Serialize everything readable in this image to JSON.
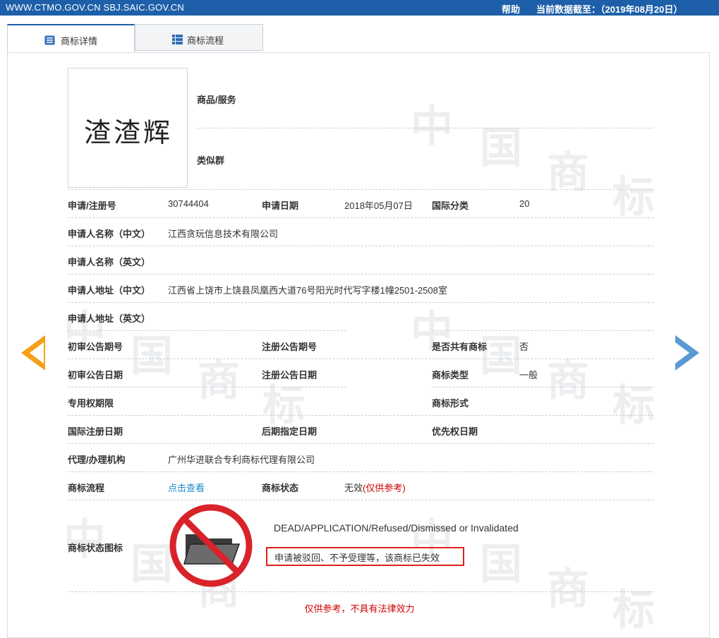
{
  "topbar": {
    "sites": "WWW.CTMO.GOV.CN SBJ.SAIC.GOV.CN",
    "help": "帮助",
    "data_date": "当前数据截至：（2019年08月20日）"
  },
  "tabs": [
    {
      "label": "商标详情",
      "icon": "list-doc-icon",
      "active": true
    },
    {
      "label": "商标流程",
      "icon": "list-grid-icon",
      "active": false
    }
  ],
  "trademark": {
    "image_text": "渣渣辉"
  },
  "goods": {
    "goods_label": "商品/服务",
    "similar_label": "类似群"
  },
  "fields": {
    "reg_no_label": "申请/注册号",
    "reg_no": "30744404",
    "app_date_label": "申请日期",
    "app_date": "2018年05月07日",
    "intl_class_label": "国际分类",
    "intl_class": "20",
    "applicant_cn_label": "申请人名称（中文）",
    "applicant_cn": "江西贪玩信息技术有限公司",
    "applicant_en_label": "申请人名称（英文）",
    "address_cn_label": "申请人地址（中文）",
    "address_cn": "江西省上饶市上饶县凤凰西大道76号阳光时代写字楼1幢2501-2508室",
    "address_en_label": "申请人地址（英文）",
    "prelim_issue_label": "初审公告期号",
    "reg_issue_label": "注册公告期号",
    "shared_label": "是否共有商标",
    "shared": "否",
    "prelim_date_label": "初审公告日期",
    "reg_date_label": "注册公告日期",
    "tm_type_label": "商标类型",
    "tm_type": "一般",
    "exclusive_label": "专用权期限",
    "tm_form_label": "商标形式",
    "intl_reg_date_label": "国际注册日期",
    "later_date_label": "后期指定日期",
    "priority_date_label": "优先权日期",
    "agent_label": "代理/办理机构",
    "agent": "广州华进联合专利商标代理有限公司",
    "flow_label": "商标流程",
    "flow_link": "点击查看",
    "status_label": "商标状态",
    "status_value": "无效",
    "status_note": "(仅供参考)"
  },
  "status_icon": {
    "label": "商标状态图标",
    "icon": "no-folder-icon",
    "en": "DEAD/APPLICATION/Refused/Dismissed or Invalidated",
    "cn": "申请被驳回、不予受理等，该商标已失效"
  },
  "disclaimer": "仅供参考，不具有法律效力",
  "watermark": [
    "中",
    "国",
    "商",
    "标"
  ],
  "colors": {
    "topbar": "#1d5fa8",
    "link": "#1a8dc8",
    "warning": "#d10000",
    "prev_arrow": "#f5a018",
    "next_arrow": "#5a9ad4"
  }
}
